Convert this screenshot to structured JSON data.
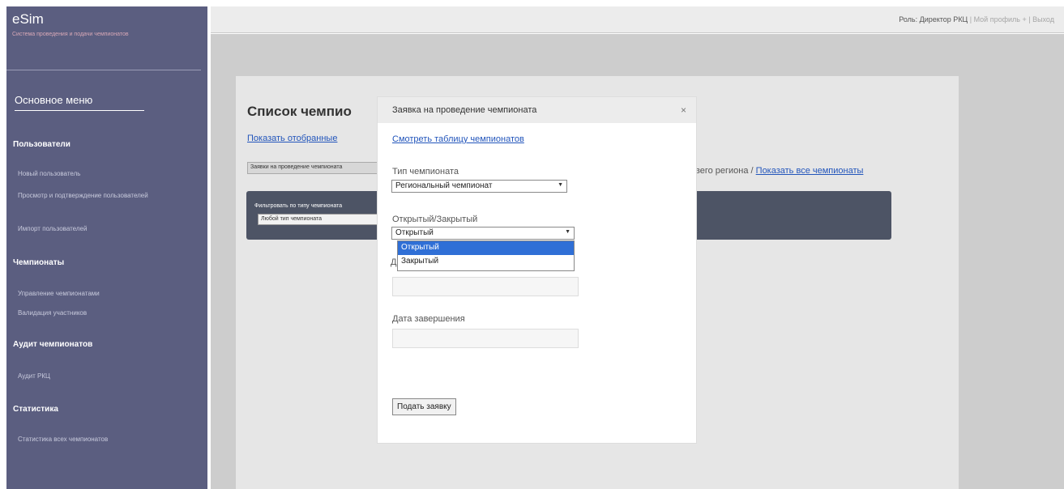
{
  "sidebar": {
    "logo": "eSim",
    "logo_subtitle": "Система проведения и подачи чемпионатов",
    "main_menu": "Основное меню",
    "sections": [
      {
        "title": "Пользователи",
        "items": [
          "Новый пользователь",
          "Просмотр и подтверждение пользователей",
          "Импорт пользователей"
        ]
      },
      {
        "title": "Чемпионаты",
        "items": [
          "Управление чемпионатами",
          "Валидация участников"
        ]
      },
      {
        "title": "Аудит чемпионатов",
        "items": [
          "Аудит РКЦ"
        ]
      },
      {
        "title": "Статистика",
        "items": [
          "Статистика всех чемпионатов"
        ]
      }
    ]
  },
  "topbar": {
    "role": "Роль: Директор РКЦ",
    "profile": "Мой профиль",
    "logout": "Выход",
    "sep1": " | ",
    "sep2": " + | "
  },
  "page": {
    "title": "Список чемпио",
    "show_selected_link": "Показать отобранные",
    "request_button": "Заявки на проведение чемпионата",
    "filter_label": "Фильтровать по типу чемпионата",
    "filter_value": "Любой тип чемпионата",
    "right_text": "вего региона",
    "right_sep": " / ",
    "show_all_link": "Показать все чемпионаты"
  },
  "modal": {
    "title": "Заявка на проведение чемпионата",
    "close": "×",
    "table_link": "Смотреть таблицу чемпионатов",
    "type_label": "Тип чемпионата",
    "type_value": "Региональный чемпионат",
    "open_closed_label": "Открытый/Закрытый",
    "open_closed_value": "Открытый",
    "open_closed_options": [
      "Открытый",
      "Закрытый"
    ],
    "hidden_label_fragment": "Д",
    "end_date_label": "Дата завершения",
    "submit": "Подать заявку"
  },
  "icons": {
    "dropdown_arrow": "chevron-down-icon",
    "close": "close-icon"
  },
  "colors": {
    "sidebar_bg": "#5b5e80",
    "filter_bar_bg": "#4d5465",
    "link": "#2255bb",
    "selected_option": "#2f6fd6"
  }
}
